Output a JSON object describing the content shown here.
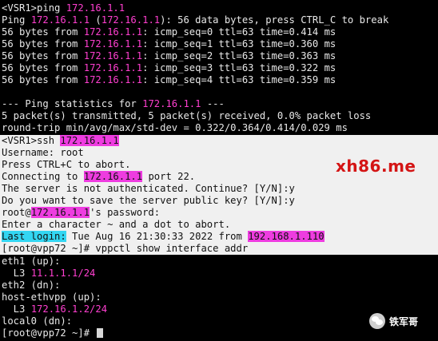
{
  "watermark": {
    "site": "xh86.me",
    "wechat": "铁军哥"
  },
  "ping": {
    "ip": "172.16.1.1",
    "cmd": {
      "prompt": "<VSR1>ping "
    },
    "header": {
      "pre": "Ping ",
      "mid": " (",
      "post": "): 56 data bytes, press CTRL_C to break"
    },
    "replies": [
      {
        "pre": "56 bytes from ",
        "post": ": icmp_seq=0 ttl=63 time=0.414 ms"
      },
      {
        "pre": "56 bytes from ",
        "post": ": icmp_seq=1 ttl=63 time=0.360 ms"
      },
      {
        "pre": "56 bytes from ",
        "post": ": icmp_seq=2 ttl=63 time=0.363 ms"
      },
      {
        "pre": "56 bytes from ",
        "post": ": icmp_seq=3 ttl=63 time=0.322 ms"
      },
      {
        "pre": "56 bytes from ",
        "post": ": icmp_seq=4 ttl=63 time=0.359 ms"
      }
    ],
    "stats_title": {
      "pre": "--- Ping statistics for ",
      "post": " ---"
    },
    "stats_packets": "5 packet(s) transmitted, 5 packet(s) received, 0.0% packet loss",
    "stats_rtt": "round-trip min/avg/max/std-dev = 0.322/0.364/0.414/0.029 ms"
  },
  "ssh": {
    "ip": "172.16.1.1",
    "cmd": "<VSR1>ssh ",
    "username": "Username: root",
    "abort": "Press CTRL+C to abort.",
    "connecting": {
      "pre": "Connecting to ",
      "post": " port 22."
    },
    "not_auth": "The server is not authenticated. Continue? [Y/N]:y",
    "save_key": "Do you want to save the server public key? [Y/N]:y",
    "password": {
      "pre": "root@",
      "post": "'s password:"
    },
    "enter_char": "Enter a character ~ and a dot to abort.",
    "last_login": {
      "label": "Last login:",
      "mid": " Tue Aug 16 21:30:33 2022 from ",
      "ip": "192.168.1.110"
    },
    "vpp_cmd": "[root@vpp72 ~]# vppctl show interface addr"
  },
  "output": {
    "eth1": "eth1 (up):",
    "eth1_l3": {
      "pre": "  L3 ",
      "ip": "11.1.1.1/24"
    },
    "eth2": "eth2 (dn):",
    "host": "host-ethvpp (up):",
    "host_l3": {
      "pre": "  L3 ",
      "ip": "172.16.1.2/24"
    },
    "local0": "local0 (dn):",
    "prompt": "[root@vpp72 ~]# "
  }
}
